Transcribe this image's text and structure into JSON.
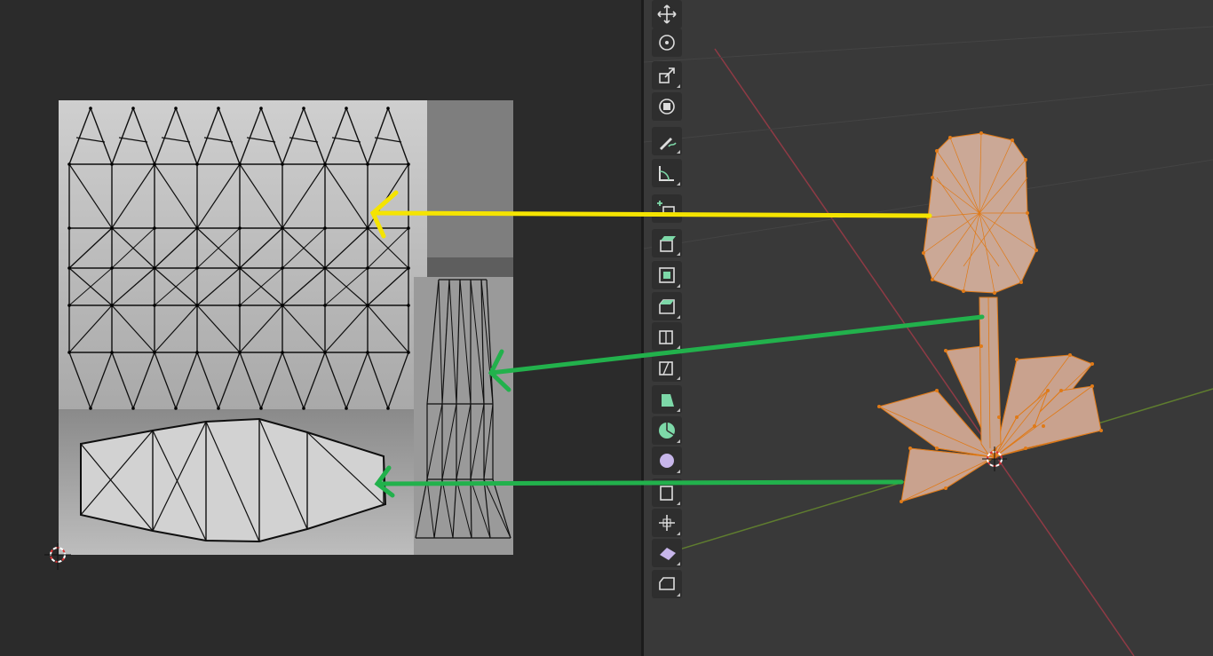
{
  "colors": {
    "uv_background": "#2b2b2b",
    "viewport_background": "#393939",
    "texture_light": "#c9c9c9",
    "texture_dark": "#7d7d7d",
    "mesh_face": "#c7a38f",
    "mesh_edge": "#e07a17",
    "arrow_yellow": "#f5e400",
    "arrow_green": "#22b14c",
    "axis_x": "#8f3a45",
    "axis_y": "#5f7d2f",
    "tool_accent": "#7dd8a8",
    "tool_purple": "#c7b6ea"
  },
  "uv_editor": {
    "image": "uv-texture-map",
    "islands": [
      "flower-head-island",
      "stem-island",
      "leaf-island"
    ],
    "cursor_icon": "2d-cursor-icon"
  },
  "viewport": {
    "object": "flower-mesh",
    "cursor_icon": "3d-cursor-icon"
  },
  "toolbar": {
    "tools": [
      {
        "name": "move-tool",
        "icon": "move-icon"
      },
      {
        "name": "rotate-tool",
        "icon": "rotate-icon"
      },
      {
        "name": "scale-tool",
        "icon": "scale-icon"
      },
      {
        "name": "transform-tool",
        "icon": "transform-icon"
      },
      {
        "name": "annotate-tool",
        "icon": "annotate-icon"
      },
      {
        "name": "measure-tool",
        "icon": "measure-icon"
      },
      {
        "name": "add-cube-tool",
        "icon": "add-cube-icon"
      },
      {
        "name": "extrude-tool",
        "icon": "extrude-icon"
      },
      {
        "name": "inset-tool",
        "icon": "inset-icon"
      },
      {
        "name": "bevel-tool",
        "icon": "bevel-icon"
      },
      {
        "name": "loop-cut-tool",
        "icon": "loop-cut-icon"
      },
      {
        "name": "knife-tool",
        "icon": "knife-icon"
      },
      {
        "name": "poly-build-tool",
        "icon": "poly-build-icon"
      },
      {
        "name": "spin-tool",
        "icon": "spin-icon"
      },
      {
        "name": "smooth-tool",
        "icon": "smooth-icon"
      },
      {
        "name": "edge-slide-tool",
        "icon": "edge-slide-icon"
      },
      {
        "name": "shrink-fatten-tool",
        "icon": "shrink-fatten-icon"
      },
      {
        "name": "shear-tool",
        "icon": "shear-icon"
      },
      {
        "name": "rip-region-tool",
        "icon": "rip-region-icon"
      }
    ]
  }
}
